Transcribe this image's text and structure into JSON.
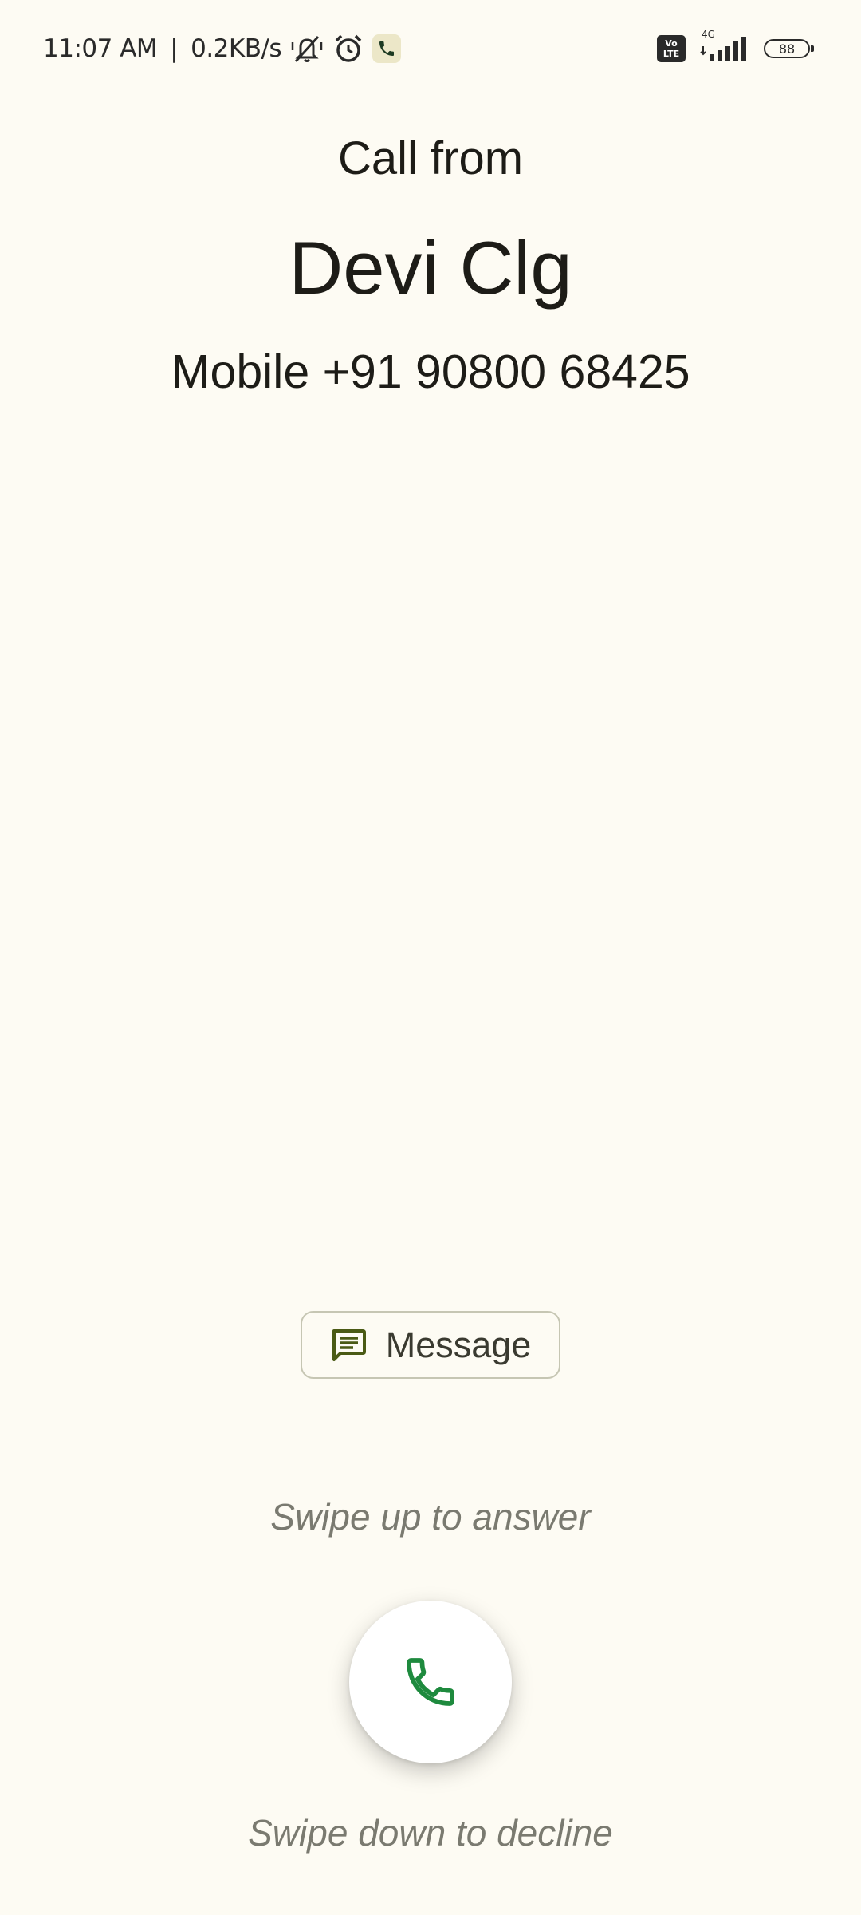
{
  "status_bar": {
    "time": "11:07 AM",
    "separator": "|",
    "net_speed": "0.2KB/s",
    "icons": [
      "silent-mode-icon",
      "alarm-icon",
      "phone-app-icon",
      "volte-icon",
      "signal-icon",
      "battery-icon"
    ],
    "volte_line1": "Vo",
    "volte_line2": "LTE",
    "network_type": "4G",
    "battery_level": "88"
  },
  "call": {
    "heading": "Call from",
    "caller_name": "Devi Clg",
    "caller_number": "Mobile +91 90800 68425"
  },
  "actions": {
    "message_label": "Message",
    "swipe_up_hint": "Swipe up to answer",
    "swipe_down_hint": "Swipe down to decline"
  },
  "colors": {
    "background": "#fdfbf3",
    "answer_icon": "#1e8a3e",
    "message_icon": "#4a5a14",
    "hint_text": "#7a7a70"
  }
}
